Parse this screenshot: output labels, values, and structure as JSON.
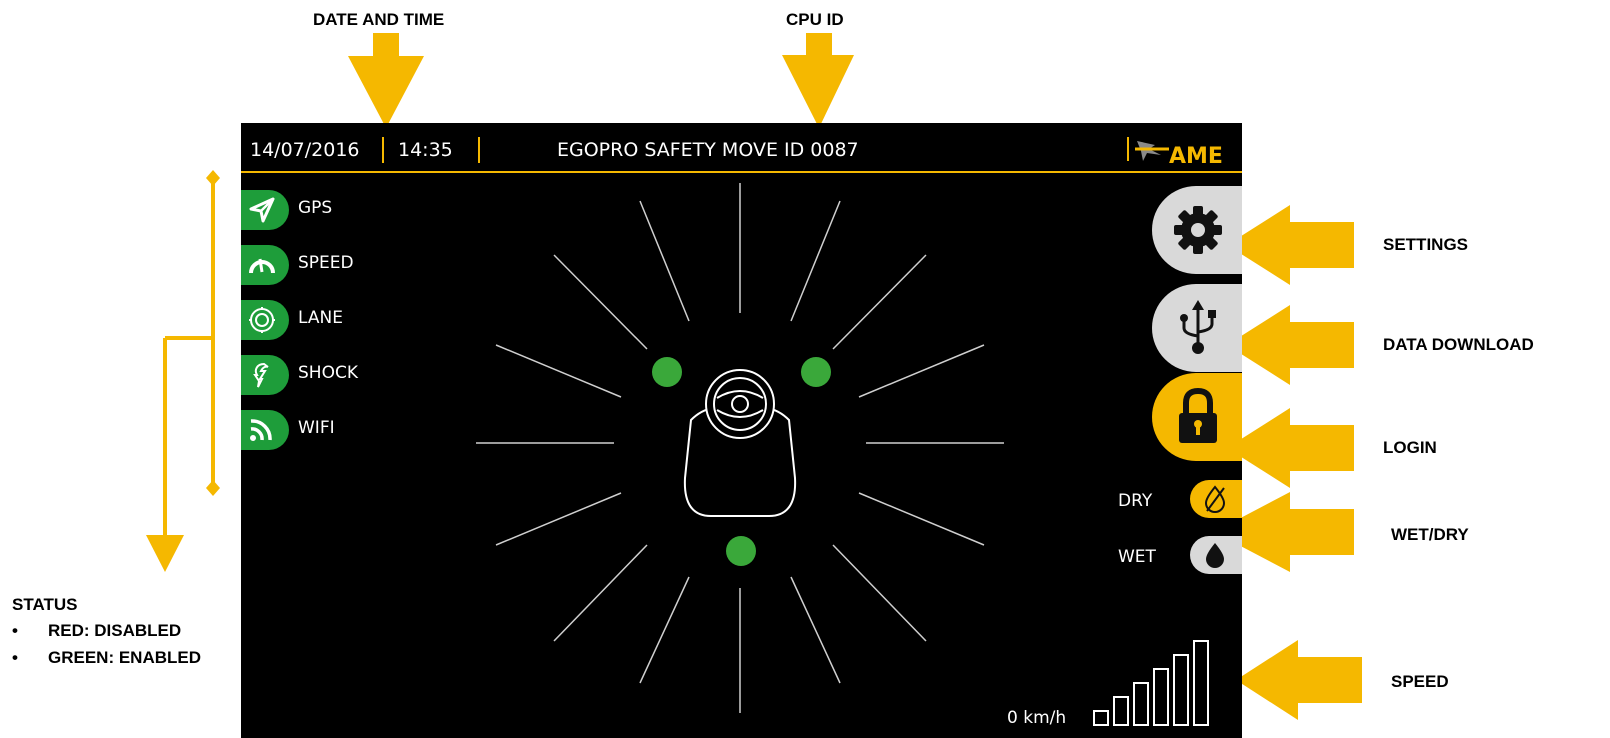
{
  "callouts": {
    "date_time": "DATE AND TIME",
    "cpu_id": "CPU ID",
    "settings": "SETTINGS",
    "data_download": "DATA DOWNLOAD",
    "login": "LOGIN",
    "wet_dry": "WET/DRY",
    "speed": "SPEED"
  },
  "status_legend": {
    "title": "STATUS",
    "items": [
      "RED: DISABLED",
      "GREEN: ENABLED"
    ]
  },
  "header": {
    "date": "14/07/2016",
    "time": "14:35",
    "device_title": "EGOPRO SAFETY MOVE ID 0087",
    "logo_text": "AME"
  },
  "status_items": [
    {
      "label": "GPS",
      "icon": "paper-plane-icon",
      "state": "enabled"
    },
    {
      "label": "SPEED",
      "icon": "speedometer-icon",
      "state": "enabled"
    },
    {
      "label": "LANE",
      "icon": "lane-target-icon",
      "state": "enabled"
    },
    {
      "label": "SHOCK",
      "icon": "shock-icon",
      "state": "enabled"
    },
    {
      "label": "WIFI",
      "icon": "wifi-icon",
      "state": "enabled"
    }
  ],
  "side_buttons": [
    {
      "name": "settings",
      "icon": "gear-icon",
      "color": "#d9d9d9"
    },
    {
      "name": "data-download",
      "icon": "usb-icon",
      "color": "#d9d9d9"
    },
    {
      "name": "login",
      "icon": "lock-icon",
      "color": "#f5b800"
    }
  ],
  "road": {
    "dry_label": "DRY",
    "wet_label": "WET",
    "selected": "DRY"
  },
  "speed": {
    "value_text": "0 km/h",
    "bar_count": 6
  },
  "colors": {
    "accent": "#f5b800",
    "enabled": "#1e9d3a",
    "screen_bg": "#000000"
  }
}
